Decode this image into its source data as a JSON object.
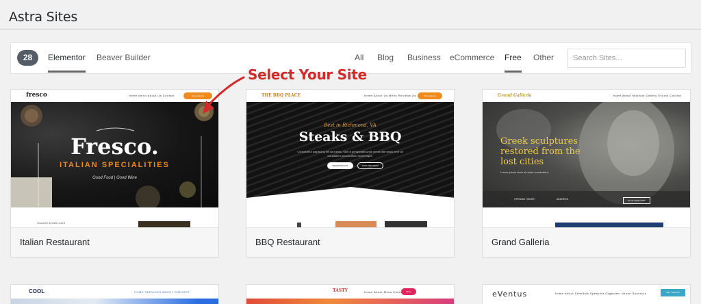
{
  "page": {
    "title": "Astra Sites"
  },
  "filter_bar": {
    "count": "28",
    "page_builders": [
      {
        "label": "Elementor",
        "active": true
      },
      {
        "label": "Beaver Builder",
        "active": false
      }
    ],
    "categories": [
      {
        "label": "All",
        "active": false
      },
      {
        "label": "Blog",
        "active": false
      },
      {
        "label": "Business",
        "active": false
      },
      {
        "label": "eCommerce",
        "active": false
      },
      {
        "label": "Free",
        "active": true
      },
      {
        "label": "Other",
        "active": false
      }
    ],
    "search_placeholder": "Search Sites..."
  },
  "annotation": {
    "callout": "Select Your Site",
    "color": "#d32a2a"
  },
  "sites": [
    {
      "title": "Italian Restaurant",
      "preview": {
        "logo": "fresco",
        "nav": "Home   Menu   About Us   Contact",
        "button": "Reservations",
        "headline": "Fresco.",
        "subheadline": "ITALIAN SPECIALITIES",
        "tagline": "Good Food | Good Wine",
        "below_caption": "Good Art Is Well Loved"
      }
    },
    {
      "title": "BBQ Restaurant",
      "preview": {
        "logo": "THE BBQ PLACE",
        "nav": "Home   About Us   Menu   Reviews Us",
        "button": "Reservations",
        "kicker": "Best in Richmond, VA",
        "headline": "Steaks & BBQ",
        "body": "Consectetur adipiscing elit sed tellus. Sed ut perspiciatis unde omnis iste natus error sit voluptatem accusantium doloremque.",
        "button_primary": "RESERVATIONS",
        "button_secondary": "EXPLORE MENU"
      }
    },
    {
      "title": "Grand Galleria",
      "preview": {
        "logo": "Grand Galleria",
        "nav": "Home   About Museum   Gallery   Events   Contact",
        "headline_lines": [
          "Greek sculptures",
          "restored from the",
          "lost cities"
        ],
        "body": "Lorem ipsum dolor sit amet consectetur.",
        "col1": "OPENING HOURS",
        "col2": "ADDRESS",
        "button": "PLAN YOUR VISIT"
      }
    },
    {
      "preview": {
        "logo": "COOL",
        "nav": "HOME   SERVICES   ABOUT   CONTACT"
      }
    },
    {
      "preview": {
        "logo": "TASTY",
        "nav": "Home   About   Menu   Contact",
        "button": "Order"
      }
    },
    {
      "preview": {
        "logo": "eVentus",
        "nav": "Home   About   Schedule   Speakers   Organizer   Venue   Sponsors",
        "button": "GET TICKETS"
      }
    }
  ]
}
